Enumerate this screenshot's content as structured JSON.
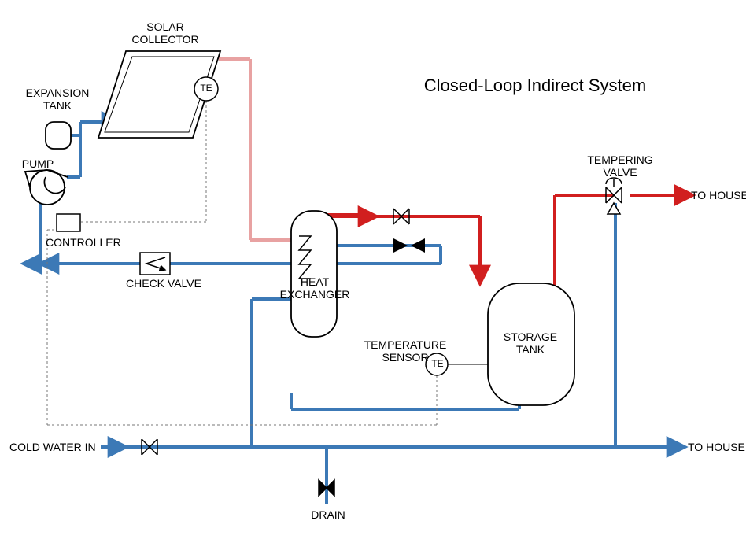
{
  "title": "Closed-Loop Indirect System",
  "labels": {
    "solar_collector": "SOLAR\nCOLLECTOR",
    "expansion_tank": "EXPANSION\nTANK",
    "pump": "PUMP",
    "controller": "CONTROLLER",
    "check_valve": "CHECK VALVE",
    "heat_exchanger": "HEAT\nEXCHANGER",
    "temperature_sensor": "TEMPERATURE\nSENSOR",
    "storage_tank": "STORAGE\nTANK",
    "tempering_valve": "TEMPERING\nVALVE",
    "cold_water_in": "COLD WATER IN",
    "to_house_top": "TO HOUSE",
    "to_house_bottom": "TO HOUSE",
    "drain": "DRAIN",
    "te1": "TE",
    "te2": "TE"
  },
  "colors": {
    "cold": "#3c79b6",
    "hot": "#d11f1f",
    "warm": "#e8a2a2",
    "thin": "#000",
    "dash": "#777"
  }
}
